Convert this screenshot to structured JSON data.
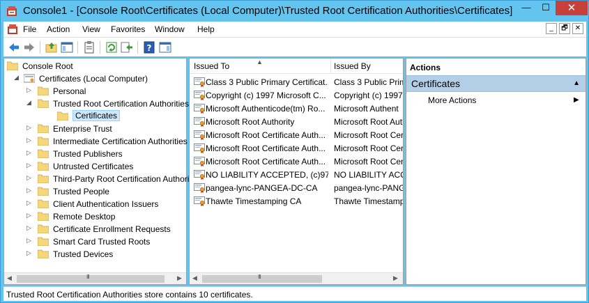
{
  "window": {
    "title": "Console1 - [Console Root\\Certificates (Local Computer)\\Trusted Root Certification Authorities\\Certificates]",
    "minimize_glyph": "—",
    "maximize_glyph": "☐",
    "close_glyph": "✕"
  },
  "menu": {
    "items": [
      "File",
      "Action",
      "View",
      "Favorites",
      "Window",
      "Help"
    ],
    "mdi_minimize": "_",
    "mdi_restore": "🗗",
    "mdi_close": "✕"
  },
  "toolbar": {
    "buttons": [
      "back-icon",
      "forward-icon",
      "up-folder-icon",
      "show-hide-tree-icon",
      "properties-icon",
      "refresh-icon",
      "export-list-icon",
      "help-icon",
      "show-hide-action-pane-icon"
    ]
  },
  "tree": {
    "root": "Console Root",
    "computer": "Certificates (Local Computer)",
    "items": [
      {
        "label": "Personal",
        "expanded": false
      },
      {
        "label": "Trusted Root Certification Authorities",
        "expanded": true
      },
      {
        "label": "Certificates",
        "selected": true,
        "child": true
      },
      {
        "label": "Enterprise Trust",
        "expanded": false
      },
      {
        "label": "Intermediate Certification Authorities",
        "expanded": false
      },
      {
        "label": "Trusted Publishers",
        "expanded": false
      },
      {
        "label": "Untrusted Certificates",
        "expanded": false
      },
      {
        "label": "Third-Party Root Certification Authorities",
        "expanded": false
      },
      {
        "label": "Trusted People",
        "expanded": false
      },
      {
        "label": "Client Authentication Issuers",
        "expanded": false
      },
      {
        "label": "Remote Desktop",
        "expanded": false
      },
      {
        "label": "Certificate Enrollment Requests",
        "expanded": false
      },
      {
        "label": "Smart Card Trusted Roots",
        "expanded": false
      },
      {
        "label": "Trusted Devices",
        "expanded": false
      }
    ],
    "scroll_grip": "III"
  },
  "list": {
    "columns": [
      "Issued To",
      "Issued By"
    ],
    "rows": [
      {
        "issued_to": "Class 3 Public Primary Certificat...",
        "issued_by": "Class 3 Public Prim"
      },
      {
        "issued_to": "Copyright (c) 1997 Microsoft C...",
        "issued_by": "Copyright (c) 1997"
      },
      {
        "issued_to": "Microsoft Authenticode(tm) Ro...",
        "issued_by": "Microsoft Authent"
      },
      {
        "issued_to": "Microsoft Root Authority",
        "issued_by": "Microsoft Root Auth"
      },
      {
        "issued_to": "Microsoft Root Certificate Auth...",
        "issued_by": "Microsoft Root Cer"
      },
      {
        "issued_to": "Microsoft Root Certificate Auth...",
        "issued_by": "Microsoft Root Cer"
      },
      {
        "issued_to": "Microsoft Root Certificate Auth...",
        "issued_by": "Microsoft Root Cer"
      },
      {
        "issued_to": "NO LIABILITY ACCEPTED, (c)97 ...",
        "issued_by": "NO LIABILITY ACC"
      },
      {
        "issued_to": "pangea-lync-PANGEA-DC-CA",
        "issued_by": "pangea-lync-PANG"
      },
      {
        "issued_to": "Thawte Timestamping CA",
        "issued_by": "Thawte Timestamp"
      }
    ],
    "scroll_grip": "III"
  },
  "actions": {
    "title": "Actions",
    "section": "Certificates",
    "items": [
      "More Actions"
    ]
  },
  "status": {
    "text": "Trusted Root Certification Authorities store contains 10 certificates."
  },
  "colors": {
    "titlebar": "#63c4f0",
    "close_button": "#c7403a",
    "selection": "#cce8ff",
    "actions_band": "#b3cfe8",
    "folder": "#f5d67a"
  }
}
